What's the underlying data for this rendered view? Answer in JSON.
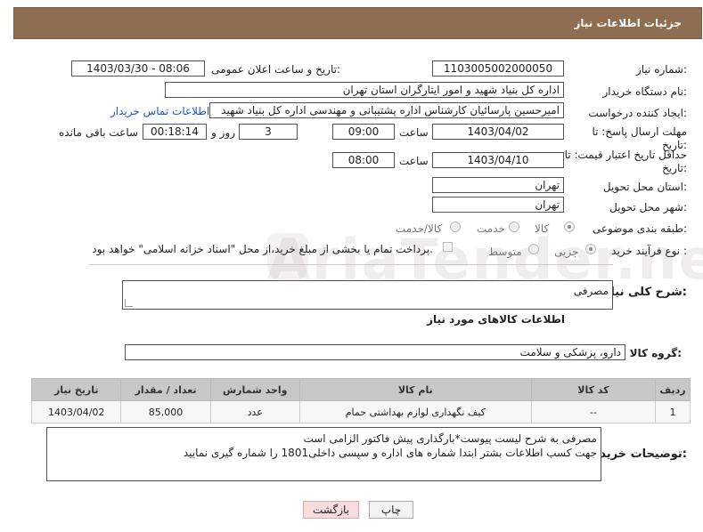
{
  "header": {
    "title": "جزئیات اطلاعات نیاز"
  },
  "watermark": {
    "text": "AriaTender.net"
  },
  "fields": {
    "need_number": {
      "label": "شماره نیاز:",
      "value": "1103005002000050"
    },
    "announce_datetime": {
      "label": "تاریخ و ساعت اعلان عمومی:",
      "value": "1403/03/30 - 08:06"
    },
    "buyer_org": {
      "label": "نام دستگاه خریدار:",
      "value": "اداره کل بنیاد شهید و امور ایثارگران استان تهران"
    },
    "requester": {
      "label": "ایجاد کننده درخواست:",
      "value": "امیرحسین پارسائیان کارشناس اداره پشتیبانی و مهندسی  اداره کل بنیاد شهید"
    },
    "buyer_contact_link": "اطلاعات تماس خریدار",
    "reply_deadline": {
      "label": "مهلت ارسال پاسخ: تا تاریخ:",
      "date": "1403/04/02",
      "time_label": "ساعت",
      "time": "09:00",
      "days": "3",
      "days_label": "روز و",
      "remaining": "00:18:14",
      "remaining_label": "ساعت باقی مانده"
    },
    "price_validity": {
      "label": "حداقل تاریخ اعتبار قیمت: تا تاریخ:",
      "date": "1403/04/10",
      "time_label": "ساعت",
      "time": "08:00"
    },
    "delivery_province": {
      "label": "استان محل تحویل:",
      "value": "تهران"
    },
    "delivery_city": {
      "label": "شهر محل تحویل:",
      "value": "تهران"
    },
    "category": {
      "label": "طبقه بندی موضوعی:",
      "options": [
        "کالا",
        "خدمت",
        "کالا/خدمت"
      ],
      "selected": "کالا"
    },
    "purchase_process": {
      "label": "نوع فرآیند خرید :",
      "options": [
        "جزیی",
        "متوسط"
      ],
      "selected": "جزیی",
      "payment_note": "پرداخت تمام یا بخشی از مبلغ خرید،از محل \"اسناد خزانه اسلامی\" خواهد بود."
    }
  },
  "need_description": {
    "label": "شرح کلی نیاز:",
    "value": "مصرفی"
  },
  "goods_section_title": "اطلاعات کالاهای مورد نیاز",
  "goods_group": {
    "label": "گروه کالا:",
    "value": "دارو، پزشکی و سلامت"
  },
  "goods_table": {
    "headers": [
      "ردیف",
      "کد کالا",
      "نام کالا",
      "واحد شمارش",
      "تعداد / مقدار",
      "تاریخ نیاز"
    ],
    "rows": [
      [
        "1",
        "--",
        "کیف نگهداری لوازم بهداشتی حمام",
        "عدد",
        "85,000",
        "1403/04/02"
      ]
    ]
  },
  "buyer_notes": {
    "label": "توضیحات خریدار:",
    "line1": "مصرفی به شرح لیست پیوست*بارگذاری پیش فاکتور الزامی است",
    "line2": "جهت کسب اطلاعات بشتر ابتدا شماره های اداره و سپسی داخلی1801 را شماره گیری نمایید"
  },
  "buttons": {
    "print": "چاپ",
    "back": "بازگشت"
  },
  "colors": {
    "header_bg": "#8e6d50",
    "table_header_bg": "#c8c8c8",
    "back_button_bg": "#f6dcdc",
    "link": "#1a56c8"
  }
}
